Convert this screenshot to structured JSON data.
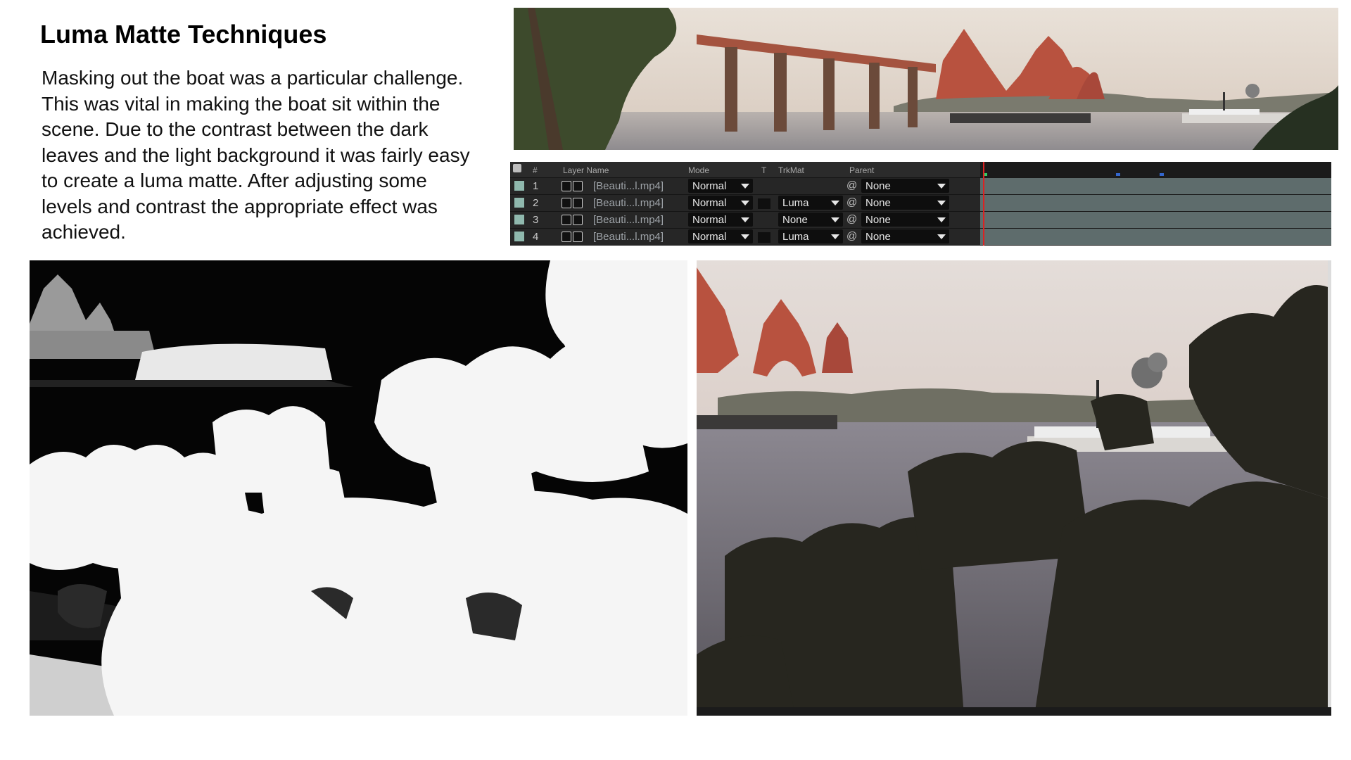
{
  "title": "Luma Matte Techniques",
  "paragraph": "Masking out the boat was a particular challenge. This was vital in making the boat sit within the scene. Due to the contrast between the dark leaves and the light background it was fairly easy to create a luma matte. After adjusting some levels and contrast the appropriate effect was achieved.",
  "timeline": {
    "headers": {
      "number": "#",
      "layer_name": "Layer Name",
      "mode": "Mode",
      "t": "T",
      "trkmat": "TrkMat",
      "parent": "Parent"
    },
    "layers": [
      {
        "index": "1",
        "name": "[Beauti...l.mp4]",
        "mode": "Normal",
        "trkmat": "",
        "parent": "None"
      },
      {
        "index": "2",
        "name": "[Beauti...l.mp4]",
        "mode": "Normal",
        "trkmat": "Luma",
        "parent": "None"
      },
      {
        "index": "3",
        "name": "[Beauti...l.mp4]",
        "mode": "Normal",
        "trkmat": "None",
        "parent": "None"
      },
      {
        "index": "4",
        "name": "[Beauti...l.mp4]",
        "mode": "Normal",
        "trkmat": "Luma",
        "parent": "None"
      }
    ]
  },
  "images": {
    "top_banner": "forth-bridge-panorama",
    "bottom_left": "luma-matte-black-white",
    "bottom_right": "composited-scene-with-boat"
  },
  "colors": {
    "label_chip": "#8fb8ad",
    "track_bar": "#5e6c6c",
    "bridge_red": "#b8523f"
  }
}
